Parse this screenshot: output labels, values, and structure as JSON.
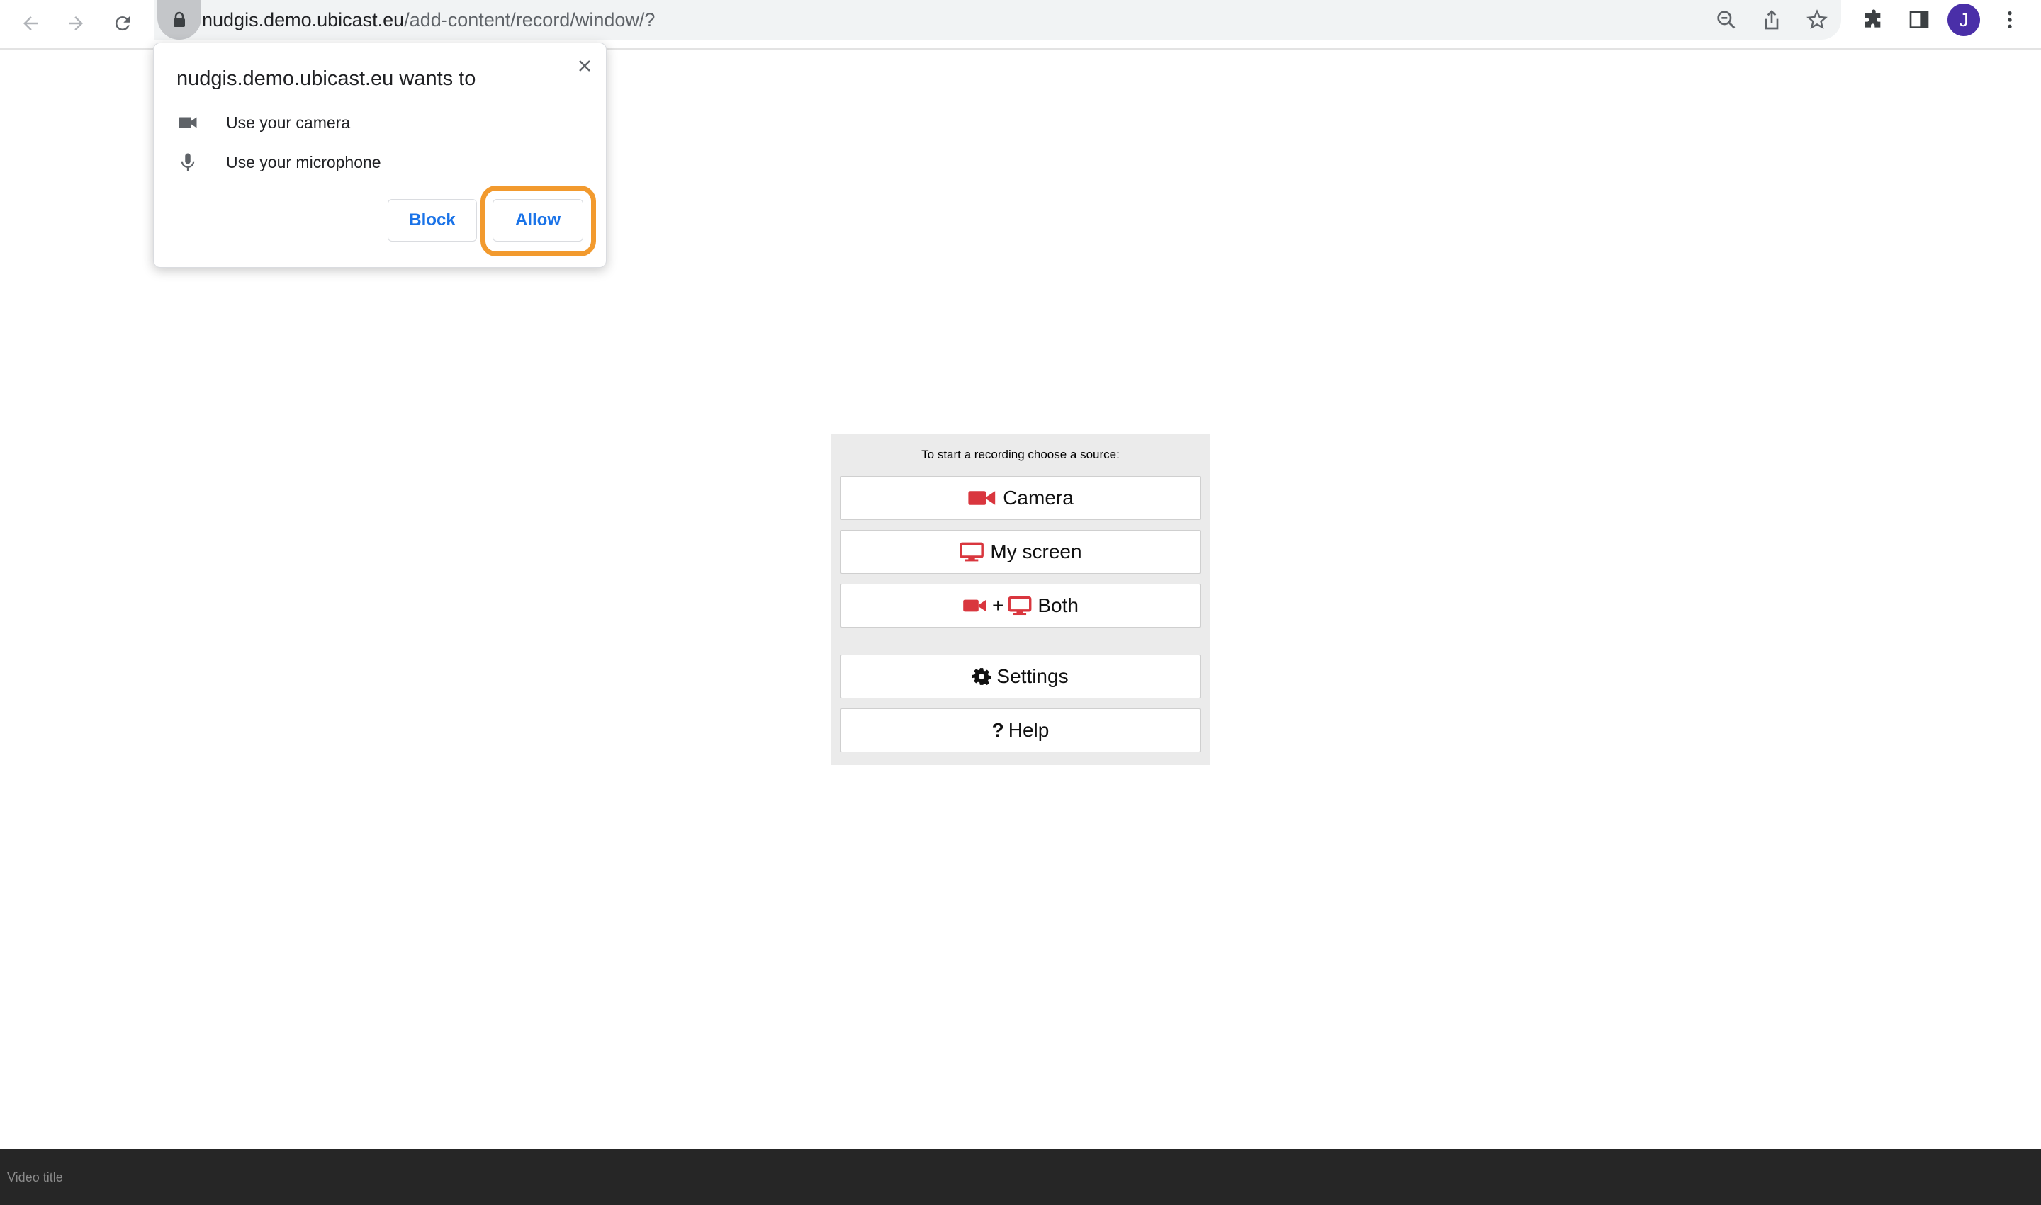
{
  "browser": {
    "url_host": "nudgis.demo.ubicast.eu",
    "url_path": "/add-content/record/window/?",
    "icons": [
      "back-icon",
      "forward-icon",
      "reload-icon",
      "lock-icon",
      "zoom-out-icon",
      "share-icon",
      "star-icon",
      "extensions-icon",
      "side-panel-icon",
      "menu-icon"
    ],
    "profile_initial": "J"
  },
  "permission_popup": {
    "title": "nudgis.demo.ubicast.eu wants to",
    "items": [
      {
        "icon": "camera-icon",
        "label": "Use your camera"
      },
      {
        "icon": "microphone-icon",
        "label": "Use your microphone"
      }
    ],
    "block_label": "Block",
    "allow_label": "Allow",
    "highlight_color": "#f29a2e"
  },
  "recorder": {
    "hint": "To start a recording choose a source:",
    "buttons": {
      "camera": "Camera",
      "screen": "My screen",
      "both_plus": "+",
      "both": "Both",
      "settings": "Settings",
      "help": "Help"
    },
    "accent_color": "#d9363e"
  },
  "footer": {
    "video_title_placeholder": "Video title"
  }
}
